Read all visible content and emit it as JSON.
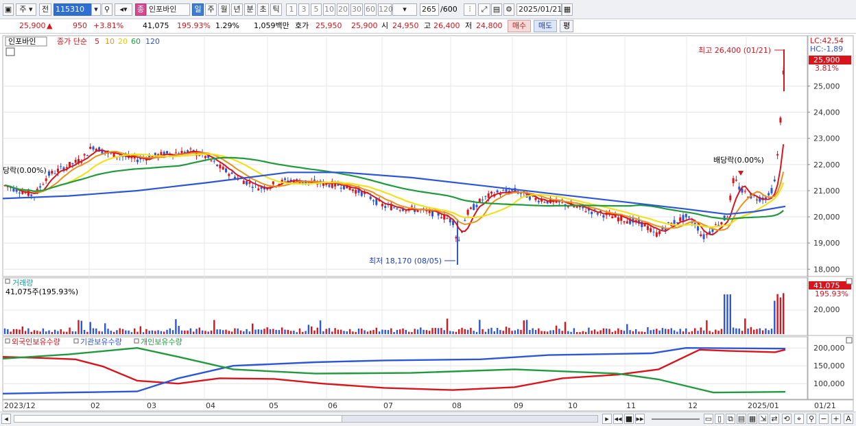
{
  "toolbar": {
    "market": "주",
    "prev": "전",
    "code": "115310",
    "stock_name": "인포바인",
    "stock_badge": "종",
    "periods": [
      {
        "label": "일",
        "selected": true
      },
      {
        "label": "주",
        "selected": false
      },
      {
        "label": "월",
        "selected": false
      },
      {
        "label": "년",
        "selected": false
      },
      {
        "label": "분",
        "selected": false
      },
      {
        "label": "초",
        "selected": false
      },
      {
        "label": "틱",
        "selected": false
      }
    ],
    "intervals": [
      "1",
      "3",
      "5",
      "10",
      "20",
      "30",
      "60",
      "120"
    ],
    "count": "265",
    "count_total": "/600",
    "date": "2025/01/21"
  },
  "quote": {
    "price": "25,900",
    "arrow": "▲",
    "change": "950",
    "change_pct": "+3.81%",
    "volume": "41,075",
    "volume_pct": "195.93%",
    "turnover_pct": "1.29%",
    "amount": "1,059백만",
    "ask_label": "호가",
    "ask": "25,950",
    "bid": "25,900",
    "open_label": "시",
    "open": "24,950",
    "high_label": "고",
    "high": "26,400",
    "low_label": "저",
    "low": "24,800",
    "buy_label": "매수",
    "sell_label": "매도",
    "flat_label": "평"
  },
  "price_chart": {
    "name_label": "인포바인",
    "legend_prefix": "종가 단순",
    "ma_labels": [
      "5",
      "10",
      "20",
      "60",
      "120"
    ],
    "ma_colors": [
      "#d8141c",
      "#e8901a",
      "#f0e020",
      "#1f9a3c",
      "#2d56d6"
    ],
    "lc": "LC:42,54",
    "hc": "HC:-1,89",
    "last_price": "25,900",
    "last_pct": "3.81%",
    "high_annot": "최고 26,400 (01/21)",
    "low_annot": "최저 18,170 (08/05)",
    "div_annot_left": "당락(0.00%)",
    "div_annot_right": "배당락(0.00%)",
    "y_ticks": [
      "25,000",
      "24,000",
      "23,000",
      "22,000",
      "21,000",
      "20,000",
      "19,000",
      "18,000"
    ]
  },
  "volume_chart": {
    "title": "거래량",
    "info": "41,075주(195.93%)",
    "last": "41,075",
    "last_pct": "195.93%",
    "y_ticks": [
      "20,000"
    ]
  },
  "holdings_chart": {
    "legend": [
      "외국인보유수량",
      "기관보유수량",
      "개인보유수량"
    ],
    "colors": [
      "#d8141c",
      "#2d56d6",
      "#1f9a3c"
    ],
    "y_ticks": [
      "200,000",
      "150,000",
      "100,000"
    ]
  },
  "x_axis": {
    "labels": [
      "2023/12",
      "02",
      "03",
      "04",
      "05",
      "06",
      "07",
      "08",
      "09",
      "10",
      "11",
      "12",
      "2025/01"
    ],
    "right_label": "01/21"
  },
  "chart_data": {
    "type": "candlestick",
    "title": "",
    "x_range": [
      "2023/12",
      "2025/01/21"
    ],
    "ylim": [
      18000,
      26400
    ],
    "series": [
      {
        "name": "종가 단순 5",
        "values": [
          21200,
          20900,
          21800,
          22400,
          22300,
          22300,
          21600,
          21100,
          21300,
          21200,
          20600,
          20200,
          19900,
          20800,
          20900,
          20700,
          20300,
          20000,
          19600,
          19800,
          20000,
          19600,
          20800,
          21000,
          25900
        ]
      },
      {
        "name": "종가 단순 120",
        "values": [
          20700,
          20800,
          20900,
          21000,
          21100,
          21300,
          21500,
          21600,
          21600,
          21500,
          21300,
          21100,
          20900,
          20700,
          20600,
          20400,
          20300,
          20200,
          20100,
          20100,
          20100,
          20100,
          20200,
          20400
        ]
      }
    ],
    "annotations": [
      {
        "label": "최고 26,400 (01/21)",
        "value": 26400
      },
      {
        "label": "최저 18,170 (08/05)",
        "value": 18170
      }
    ]
  }
}
